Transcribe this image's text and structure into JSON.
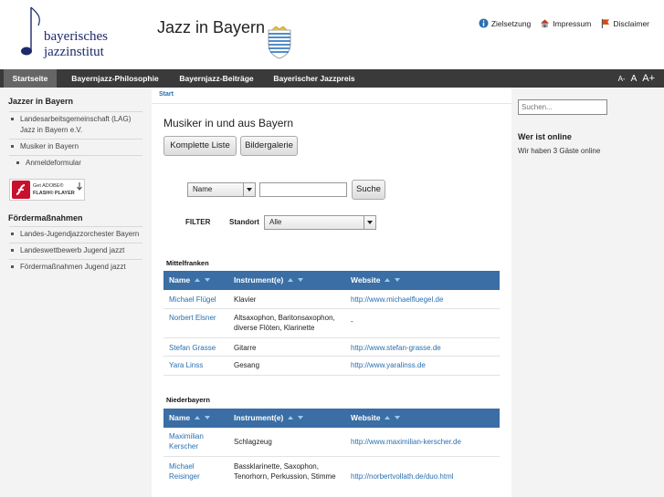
{
  "header": {
    "logo_line1": "bayerisches",
    "logo_line2": "jazzinstitut",
    "site_title": "Jazz in Bayern",
    "top_links": [
      {
        "label": "Zielsetzung",
        "icon": "info-icon"
      },
      {
        "label": "Impressum",
        "icon": "house-icon"
      },
      {
        "label": "Disclaimer",
        "icon": "flag-icon"
      }
    ]
  },
  "nav": {
    "items": [
      "Startseite",
      "Bayernjazz-Philosophie",
      "Bayernjazz-Beiträge",
      "Bayerischer Jazzpreis"
    ],
    "active": "Startseite",
    "font_controls": [
      "A-",
      "A",
      "A+"
    ]
  },
  "left": {
    "section1_title": "Jazzer in Bayern",
    "section1_items": [
      "Landesarbeitsgemeinschaft (LAG) Jazz in Bayern e.V.",
      "Musiker in Bayern",
      "Anmeldeformular"
    ],
    "flash_line1": "Get ADOBE®",
    "flash_line2": "FLASH® PLAYER",
    "section2_title": "Fördermaßnahmen",
    "section2_items": [
      "Landes-Jugendjazzorchester Bayern",
      "Landeswettbewerb Jugend jazzt",
      "Fördermaßnahmen Jugend jazzt"
    ]
  },
  "content": {
    "breadcrumb": "Start",
    "page_title": "Musiker in und aus Bayern",
    "buttons": [
      "Komplette Liste",
      "Bildergalerie"
    ],
    "search_field_select": "Name",
    "search_input_value": "",
    "search_button": "Suche",
    "filter_label": "FILTER",
    "standort_label": "Standort",
    "standort_value": "Alle",
    "columns": [
      "Name",
      "Instrument(e)",
      "Website"
    ],
    "regions": [
      {
        "name": "Mittelfranken",
        "rows": [
          {
            "name": "Michael Flügel",
            "instrument": "Klavier",
            "website": "http://www.michaelfluegel.de"
          },
          {
            "name": "Norbert Elsner",
            "instrument": "Altsaxophon, Baritonsaxophon, diverse Flöten, Klarinette",
            "website": "-"
          },
          {
            "name": "Stefan Grasse",
            "instrument": "Gitarre",
            "website": "http://www.stefan-grasse.de"
          },
          {
            "name": "Yara Linss",
            "instrument": "Gesang",
            "website": "http://www.yaralinss.de"
          }
        ]
      },
      {
        "name": "Niederbayern",
        "rows": [
          {
            "name": "Maximilian Kerscher",
            "instrument": "Schlagzeug",
            "website": "http://www.maximilian-kerscher.de"
          },
          {
            "name": "Michael Reisinger",
            "instrument": "Bassklarinette, Saxophon, Tenorhorn, Perkussion, Stimme",
            "website": "http://norbertvollath.de/duo.html"
          }
        ]
      }
    ]
  },
  "right": {
    "search_placeholder": "Suchen...",
    "online_title": "Wer ist online",
    "online_text": "Wir haben 3 Gäste online"
  }
}
